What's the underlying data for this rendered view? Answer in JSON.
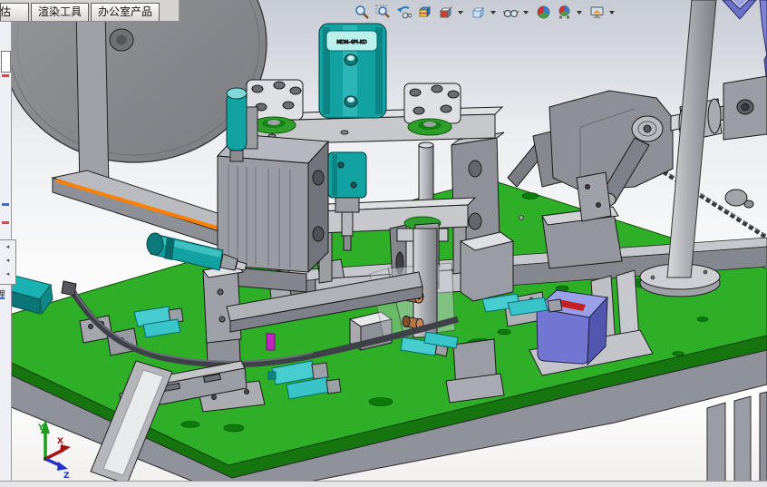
{
  "tabbar": {
    "tabs": [
      {
        "label": "评估"
      },
      {
        "label": "渲染工具"
      },
      {
        "label": "办公室产品"
      }
    ]
  },
  "hud_toolbar": {
    "icons": [
      {
        "name": "zoom-to-fit",
        "has_dropdown": false
      },
      {
        "name": "zoom-to-area",
        "has_dropdown": false
      },
      {
        "name": "previous-view",
        "has_dropdown": false
      },
      {
        "name": "section-view",
        "has_dropdown": false
      },
      {
        "name": "view-orientation",
        "has_dropdown": true
      },
      {
        "name": "display-style",
        "has_dropdown": true
      },
      {
        "name": "hide-show-items",
        "has_dropdown": true
      },
      {
        "name": "edit-appearance",
        "has_dropdown": false
      },
      {
        "name": "apply-scene",
        "has_dropdown": true
      },
      {
        "name": "view-settings",
        "has_dropdown": true
      }
    ]
  },
  "left_panel": {
    "collapse_arrow": "◂",
    "vertical_tab_label": "理"
  },
  "viewport": {
    "triad": {
      "x_label": "X",
      "y_label": "Y",
      "z_label": "Z"
    },
    "model_labels": {
      "top_cylinder": "MDN-4PI-KD"
    }
  },
  "colors": {
    "table_green": "#2fae28",
    "table_green_dark": "#16750e",
    "hole_green": "#0b7c0a",
    "teal": "#12a2a2",
    "teal_light": "#7fd8d8",
    "cyan": "#47ccd0",
    "orange": "#ff7f00",
    "motor_purple": "#7276d2",
    "motor_purple_light": "#9aa0e8",
    "motor_purple_dark": "#5156ae",
    "label_red": "#c42222",
    "magenta": "#c026c0",
    "copper": "#b5764a",
    "gray_plate": "#c7c8cc",
    "gray_mid": "#9a9ca4",
    "gray_dark": "#72747c",
    "chrome": "#d6d4d0",
    "panel_bg": "#eef0f5",
    "axis_green": "#1f9a1f",
    "axis_red": "#a51212",
    "axis_blue": "#2233cc",
    "chevron_purple": "#6a6fc8"
  }
}
